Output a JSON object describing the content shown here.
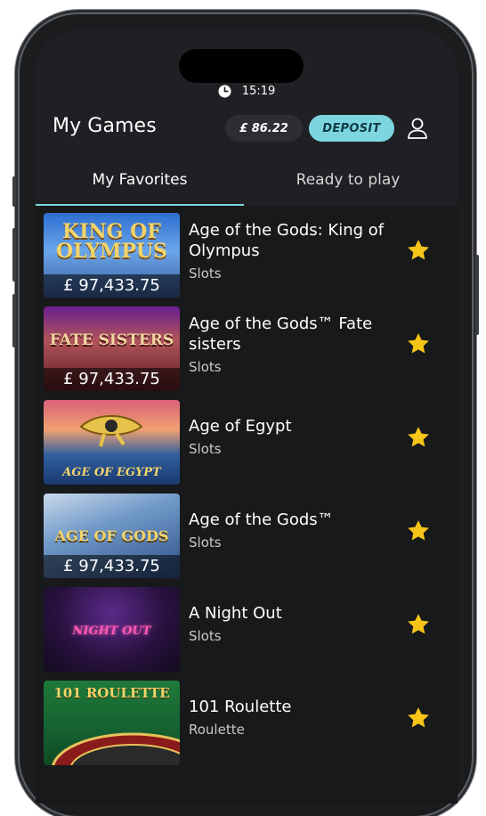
{
  "status": {
    "time": "15:19"
  },
  "header": {
    "title": "My Games",
    "balance": "£ 86.22",
    "deposit_label": "DEPOSIT"
  },
  "tabs": [
    {
      "label": "My Favorites",
      "active": true
    },
    {
      "label": "Ready to play",
      "active": false
    }
  ],
  "games": [
    {
      "name": "Age of the Gods: King of Olympus",
      "category": "Slots",
      "jackpot": "£ 97,433.75",
      "thumb_text": "KING OF OLYMPUS",
      "favorite": true
    },
    {
      "name": "Age of the Gods™ Fate sisters",
      "category": "Slots",
      "jackpot": "£ 97,433.75",
      "thumb_text": "FATE SISTERS",
      "favorite": true
    },
    {
      "name": "Age of Egypt",
      "category": "Slots",
      "jackpot": "",
      "thumb_text": "AGE OF EGYPT",
      "favorite": true
    },
    {
      "name": "Age of the Gods™",
      "category": "Slots",
      "jackpot": "£ 97,433.75",
      "thumb_text": "AGE OF GODS",
      "favorite": true
    },
    {
      "name": "A Night Out",
      "category": "Slots",
      "jackpot": "",
      "thumb_text": "NIGHT OUT",
      "favorite": true
    },
    {
      "name": "101 Roulette",
      "category": "Roulette",
      "jackpot": "",
      "thumb_text": "101 ROULETTE",
      "favorite": true
    }
  ],
  "colors": {
    "accent": "#7dd6df",
    "star": "#f5c518",
    "background": "#1f2024"
  }
}
